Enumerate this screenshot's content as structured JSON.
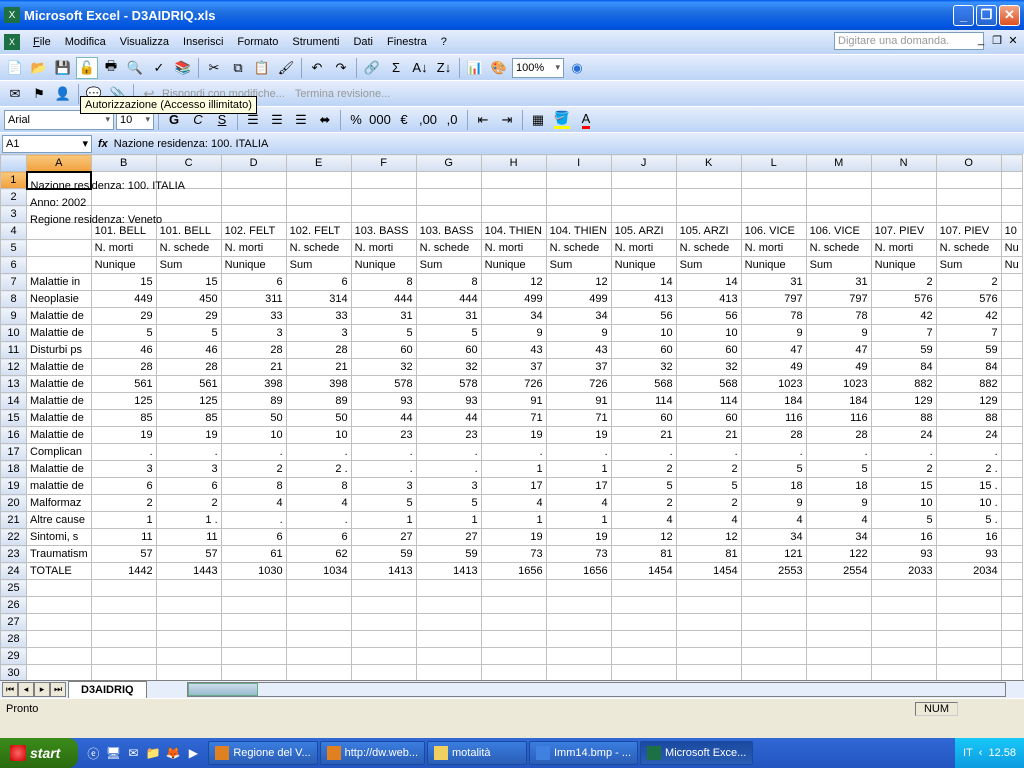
{
  "window": {
    "title": "Microsoft Excel - D3AIDRIQ.xls"
  },
  "menu": {
    "file": "File",
    "edit": "Modifica",
    "view": "Visualizza",
    "insert": "Inserisci",
    "format": "Formato",
    "tools": "Strumenti",
    "data": "Dati",
    "window": "Finestra",
    "help": "?"
  },
  "askbox": "Digitare una domanda.",
  "tooltip": "Autorizzazione (Accesso illimitato)",
  "review": {
    "reply": "Rispondi con modifiche...",
    "end": "Termina revisione..."
  },
  "zoom": "100%",
  "font": {
    "name": "Arial",
    "size": "10"
  },
  "namebox": "A1",
  "formula": "Nazione residenza: 100. ITALIA",
  "cols": [
    "A",
    "B",
    "C",
    "D",
    "E",
    "F",
    "G",
    "H",
    "I",
    "J",
    "K",
    "L",
    "M",
    "N",
    "O"
  ],
  "header1": [
    "Nazione residenza: 100. ITALIA"
  ],
  "row2": "Anno: 2002",
  "row3": "Regione residenza: Veneto",
  "row4": [
    "",
    "101. BELL",
    "101. BELL",
    "102. FELT",
    "102. FELT",
    "103. BASS",
    "103. BASS",
    "104. THIEN",
    "104. THIEN",
    "105. ARZI",
    "105. ARZI",
    "106. VICE",
    "106. VICE",
    "107. PIEV",
    "107. PIEV"
  ],
  "row5": [
    "",
    "N. morti",
    "N. schede",
    "N. morti",
    "N. schede",
    "N. morti",
    "N. schede",
    "N. morti",
    "N. schede",
    "N. morti",
    "N. schede",
    "N. morti",
    "N. schede",
    "N. morti",
    "N. schede"
  ],
  "row6": [
    "",
    "Nunique",
    "Sum",
    "Nunique",
    "Sum",
    "Nunique",
    "Sum",
    "Nunique",
    "Sum",
    "Nunique",
    "Sum",
    "Nunique",
    "Sum",
    "Nunique",
    "Sum"
  ],
  "data_rows": [
    {
      "n": 7,
      "label": "Malattie in",
      "v": [
        15,
        15,
        6,
        6,
        8,
        8,
        12,
        12,
        14,
        14,
        31,
        31,
        2,
        2
      ]
    },
    {
      "n": 8,
      "label": "Neoplasie",
      "v": [
        449,
        450,
        311,
        314,
        444,
        444,
        499,
        499,
        413,
        413,
        797,
        797,
        576,
        576
      ]
    },
    {
      "n": 9,
      "label": "Malattie de",
      "v": [
        29,
        29,
        33,
        33,
        31,
        31,
        34,
        34,
        56,
        56,
        78,
        78,
        42,
        42
      ]
    },
    {
      "n": 10,
      "label": "Malattie de",
      "v": [
        5,
        5,
        3,
        3,
        5,
        5,
        9,
        9,
        10,
        10,
        9,
        9,
        7,
        7
      ]
    },
    {
      "n": 11,
      "label": "Disturbi ps",
      "v": [
        46,
        46,
        28,
        28,
        60,
        60,
        43,
        43,
        60,
        60,
        47,
        47,
        59,
        59
      ]
    },
    {
      "n": 12,
      "label": "Malattie de",
      "v": [
        28,
        28,
        21,
        21,
        32,
        32,
        37,
        37,
        32,
        32,
        49,
        49,
        84,
        84
      ]
    },
    {
      "n": 13,
      "label": "Malattie de",
      "v": [
        561,
        561,
        398,
        398,
        578,
        578,
        726,
        726,
        568,
        568,
        1023,
        1023,
        882,
        882
      ]
    },
    {
      "n": 14,
      "label": "Malattie de",
      "v": [
        125,
        125,
        89,
        89,
        93,
        93,
        91,
        91,
        114,
        114,
        184,
        184,
        129,
        129
      ]
    },
    {
      "n": 15,
      "label": "Malattie de",
      "v": [
        85,
        85,
        50,
        50,
        44,
        44,
        71,
        71,
        60,
        60,
        116,
        116,
        88,
        88
      ]
    },
    {
      "n": 16,
      "label": "Malattie de",
      "v": [
        19,
        19,
        10,
        10,
        23,
        23,
        19,
        19,
        21,
        21,
        28,
        28,
        24,
        24
      ]
    },
    {
      "n": 17,
      "label": "Complican",
      "v": [
        ".",
        ".",
        ".",
        ".",
        ".",
        ".",
        ".",
        ".",
        ".",
        ".",
        ".",
        ".",
        ".",
        "."
      ]
    },
    {
      "n": 18,
      "label": "Malattie de",
      "v": [
        3,
        3,
        2,
        "2 .",
        ".",
        ".",
        1,
        1,
        2,
        2,
        5,
        5,
        2,
        "2 ."
      ]
    },
    {
      "n": 19,
      "label": "malattie de",
      "v": [
        6,
        6,
        8,
        8,
        3,
        3,
        17,
        17,
        5,
        5,
        18,
        18,
        15,
        "15 ."
      ]
    },
    {
      "n": 20,
      "label": "Malformaz",
      "v": [
        2,
        2,
        4,
        4,
        5,
        5,
        4,
        4,
        2,
        2,
        9,
        9,
        10,
        "10 ."
      ]
    },
    {
      "n": 21,
      "label": "Altre cause",
      "v": [
        1,
        "1 .",
        ".",
        ".",
        1,
        1,
        1,
        1,
        4,
        4,
        4,
        4,
        5,
        "5 ."
      ]
    },
    {
      "n": 22,
      "label": "Sintomi, s",
      "v": [
        11,
        11,
        6,
        6,
        27,
        27,
        19,
        19,
        12,
        12,
        34,
        34,
        16,
        16
      ]
    },
    {
      "n": 23,
      "label": "Traumatism",
      "v": [
        57,
        57,
        61,
        62,
        59,
        59,
        73,
        73,
        81,
        81,
        121,
        122,
        93,
        93
      ]
    },
    {
      "n": 24,
      "label": "TOTALE",
      "v": [
        1442,
        1443,
        1030,
        1034,
        1413,
        1413,
        1656,
        1656,
        1454,
        1454,
        2553,
        2554,
        2033,
        2034
      ]
    }
  ],
  "sheet": "D3AIDRIQ",
  "status": "Pronto",
  "numlabel": "NUM",
  "taskbar": {
    "start": "start",
    "btns": [
      {
        "label": "Regione del V...",
        "color": "#e08020"
      },
      {
        "label": "http://dw.web...",
        "color": "#e08020"
      },
      {
        "label": "motalità",
        "color": "#f0d060"
      },
      {
        "label": "Imm14.bmp - ...",
        "color": "#4080e0"
      },
      {
        "label": "Microsoft Exce...",
        "color": "#1d7044"
      }
    ],
    "lang": "IT",
    "clock": "12.58"
  }
}
